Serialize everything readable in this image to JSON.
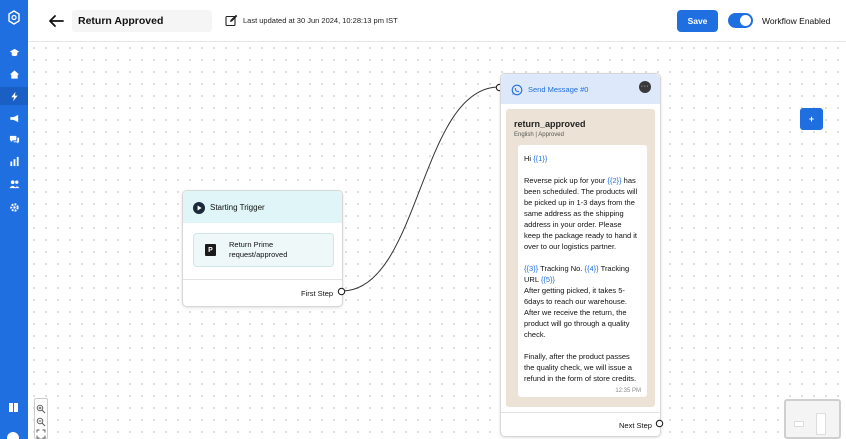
{
  "header": {
    "title": "Return Approved",
    "last_updated": "Last updated at 30 Jun 2024, 10:28:13 pm IST",
    "save_label": "Save",
    "workflow_label": "Workflow Enabled"
  },
  "trigger_node": {
    "title": "Starting Trigger",
    "logo_text": "P",
    "card_line1": "Return Prime",
    "card_line2": "request/approved",
    "step_label": "First Step"
  },
  "message_node": {
    "title": "Send Message #0",
    "template_name": "return_approved",
    "template_meta": "English | Approved",
    "greeting_text": "Hi ",
    "var1": "{{1}}",
    "p2_a": "Reverse pick up for your ",
    "var2": "{{2}}",
    "p2_b1": " has",
    "p2_b2": "been scheduled. The products will",
    "p2_b3": "be picked up in 1-3 days from the",
    "p2_b4": "same address as the shipping",
    "p2_b5": "address in your order. Please",
    "p2_b6": "keep the package ready to hand it",
    "p2_b7": "over to our logistics partner.",
    "var3": "{{3}}",
    "p3_a": " Tracking No. ",
    "var4": "{{4}}",
    "p3_b": " Tracking",
    "p3_c": "URL ",
    "var5": "{{5}}",
    "p3_d1": "After getting picked, it takes 5-",
    "p3_d2": "6days to reach our warehouse.",
    "p3_d3": "After we receive the return, the",
    "p3_d4": "product will go through a quality",
    "p3_d5": "check.",
    "p4_1": "Finally, after the product passes",
    "p4_2": "the quality check, we will issue a",
    "p4_3": "refund in the form of store credits.",
    "time": "12:35 PM",
    "step_label": "Next Step"
  },
  "add_button_label": "+",
  "colors": {
    "primary": "#1f6fe0",
    "trigger_header": "#dff5f7",
    "message_header": "#dde8fb",
    "chat_bg": "#ece3d6"
  },
  "icons": {
    "sidebar": [
      "logo-icon",
      "graduation-icon",
      "home-icon",
      "lightning-icon",
      "megaphone-icon",
      "chat-icon",
      "bar-chart-icon",
      "users-icon",
      "gear-icon"
    ],
    "bottom": [
      "book-icon",
      "avatar"
    ]
  }
}
